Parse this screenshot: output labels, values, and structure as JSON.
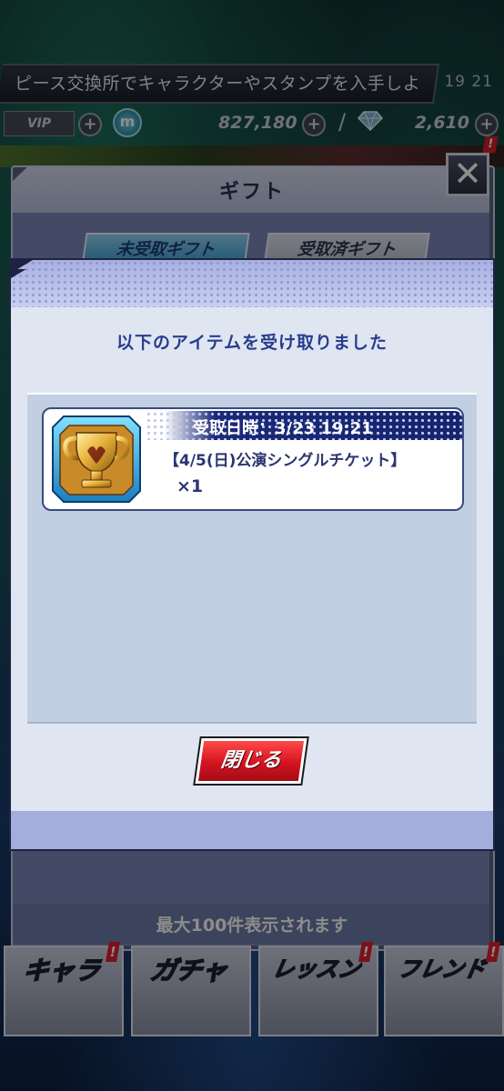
{
  "status_bar": {
    "ticker_text": "ピース交換所でキャラクターやスタンプを入手しよ",
    "time": "19 21"
  },
  "currency": {
    "vip_label": "VIP",
    "m_label": "m",
    "coins": "827,180",
    "separator": "/",
    "gems": "2,610",
    "plus": "+"
  },
  "gift_dialog": {
    "title": "ギフト",
    "close_label": "✕",
    "tabs": [
      {
        "label": "未受取ギフト",
        "active": true
      },
      {
        "label": "受取済ギフト",
        "active": false
      }
    ],
    "footer": "最大100件表示されます"
  },
  "result_modal": {
    "message": "以下のアイテムを受け取りました",
    "items": [
      {
        "received": "受取日時：3/23 19:21",
        "name": "【4/5(日)公演シングルチケット】",
        "quantity": "×1",
        "icon": "gold-trophy-icon"
      }
    ],
    "close_button": "閉じる"
  },
  "bottom_nav": {
    "items": [
      {
        "label": "キャラ",
        "badge": "!"
      },
      {
        "label": "ガチャ",
        "badge": ""
      },
      {
        "label": "レッスン",
        "badge": "!"
      },
      {
        "label": "フレンド",
        "badge": "!"
      }
    ]
  },
  "colors": {
    "accent_blue": "#2a3d8c",
    "close_red": "#d41320",
    "date_bar": "#16246e"
  }
}
